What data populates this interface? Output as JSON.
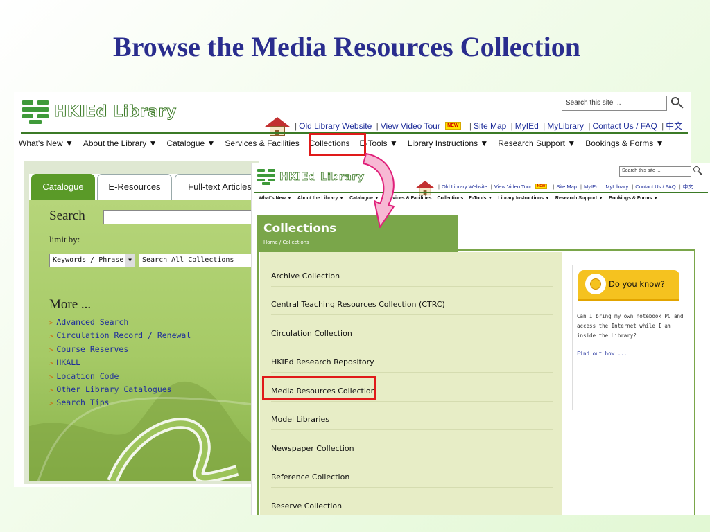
{
  "slide": {
    "title": "Browse the Media Resources Collection"
  },
  "site": {
    "logo_text": "HKIEd Library",
    "search_placeholder": "Search this site ...",
    "top_links": [
      "Old Library Website",
      "View Video Tour",
      "Site Map",
      "MyIEd",
      "MyLibrary",
      "Contact Us / FAQ",
      "中文"
    ],
    "new_badge": "NEW",
    "nav": [
      "What's New ▼",
      "About the Library ▼",
      "Catalogue ▼",
      "Services & Facilities",
      "Collections",
      "E-Tools ▼",
      "Library Instructions ▼",
      "Research Support ▼",
      "Bookings & Forms ▼"
    ]
  },
  "catalogue_panel": {
    "tabs": [
      "Catalogue",
      "E-Resources",
      "Full-text Articles"
    ],
    "search_label": "Search",
    "limit_label": "limit by:",
    "keyword_select": "Keywords / Phrase",
    "collection_select": "Search All Collections",
    "more_title": "More ...",
    "more_links": [
      "Advanced Search",
      "Circulation Record / Renewal",
      "Course Reserves",
      "HKALL",
      "Location Code",
      "Other Library Catalogues",
      "Search Tips"
    ]
  },
  "collections_page": {
    "title": "Collections",
    "breadcrumb": "Home / Collections",
    "items": [
      "Archive Collection",
      "Central Teaching Resources Collection (CTRC)",
      "Circulation Collection",
      "HKIEd Research Repository",
      "Media Resources Collection",
      "Model Libraries",
      "Newspaper Collection",
      "Reference Collection",
      "Reserve Collection"
    ],
    "highlighted_item": "Media Resources Collection",
    "sidebar": {
      "heading": "Do you know?",
      "body": "Can I bring my own notebook PC and access the Internet while I am inside the Library?",
      "link": "Find out how ..."
    }
  },
  "colors": {
    "title": "#2a2d8e",
    "highlight": "#e01a1a",
    "accent_green": "#7aa64a",
    "arrow_fill": "#f7b9d4",
    "arrow_stroke": "#e0207a"
  }
}
